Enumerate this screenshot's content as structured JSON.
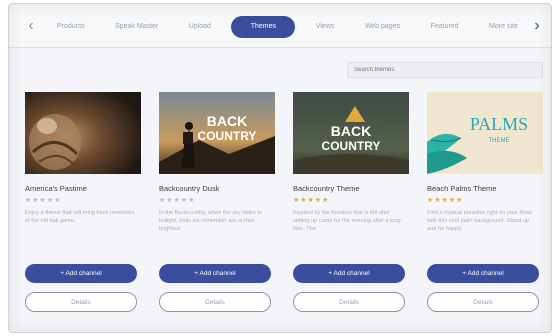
{
  "tabs": {
    "items": [
      {
        "label": "Products"
      },
      {
        "label": "Speak Master"
      },
      {
        "label": "Upload"
      },
      {
        "label": "Themes"
      },
      {
        "label": "Views"
      },
      {
        "label": "Web pages"
      },
      {
        "label": "Featured"
      },
      {
        "label": "More site"
      }
    ],
    "active_index": 3,
    "left_arrow": "‹",
    "right_arrow": "›"
  },
  "search": {
    "placeholder": "Search themes"
  },
  "cards": [
    {
      "title": "America's Pastime",
      "stars": "★★★★★",
      "rated": false,
      "description": "Enjoy a theme that will bring back memories of the old ball game.",
      "add_label": "+ Add channel",
      "details_label": "Details"
    },
    {
      "title": "Backcountry Dusk",
      "thumb_text_line1": "BACK",
      "thumb_text_line2": "COUNTRY",
      "stars": "★★★★★",
      "rated": false,
      "description": "In the Backcountry, when the sky fades to twilight, trails we remember are at their brightest.",
      "add_label": "+ Add channel",
      "details_label": "Details"
    },
    {
      "title": "Backcountry Theme",
      "thumb_text_line1": "BACK",
      "thumb_text_line2": "COUNTRY",
      "stars": "★★★★★",
      "rated": true,
      "description": "Inspired by the freedom that is felt after setting up camp for the evening after a long hike. The",
      "add_label": "+ Add channel",
      "details_label": "Details"
    },
    {
      "title": "Beach Palms Theme",
      "thumb_text_line1": "PALMS",
      "thumb_text_line2": "THEME",
      "stars": "★★★★★",
      "rated": true,
      "description": "Find a tropical paradise right on your Roku with this cool palm background. Stand up and be happy.",
      "add_label": "+ Add channel",
      "details_label": "Details"
    }
  ],
  "colors": {
    "accent": "#3b4e9e",
    "star_gold": "#e5a93a",
    "star_grey": "#b9bcc4"
  }
}
